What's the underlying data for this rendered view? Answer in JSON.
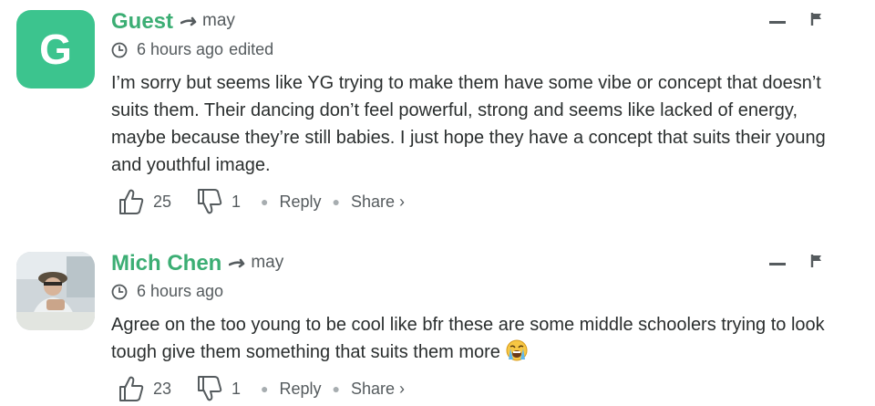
{
  "comments": [
    {
      "author": "Guest",
      "avatar_letter": "G",
      "reply_to": "may",
      "time": "6 hours ago",
      "edited_label": "edited",
      "text": "I’m sorry but seems like YG trying to make them have some vibe or concept that doesn’t suits them. Their dancing don’t feel powerful, strong and seems like lacked of energy, maybe because they’re still babies. I just hope they have a concept that suits their young and youthful image.",
      "upvotes": "25",
      "downvotes": "1",
      "reply_label": "Reply",
      "share_label": "Share ›"
    },
    {
      "author": "Mich Chen",
      "reply_to": "may",
      "time": "6 hours ago",
      "text": "Agree on the too young to be cool like bfr these are some middle schoolers trying to look tough give them something that suits them more",
      "emoji": "loudly-crying-face",
      "upvotes": "23",
      "downvotes": "1",
      "reply_label": "Reply",
      "share_label": "Share ›"
    }
  ],
  "icons": {
    "upvote": "thumbs-up-icon",
    "downvote": "thumbs-down-icon",
    "clock": "clock-icon",
    "reply_arrow": "reply-arrow-icon",
    "flag": "flag-icon",
    "collapse": "minus-icon"
  },
  "colors": {
    "author": "#3cae74",
    "avatar_bg": "#3cc48e",
    "text": "#2a2e2e",
    "muted": "#555b5e"
  }
}
